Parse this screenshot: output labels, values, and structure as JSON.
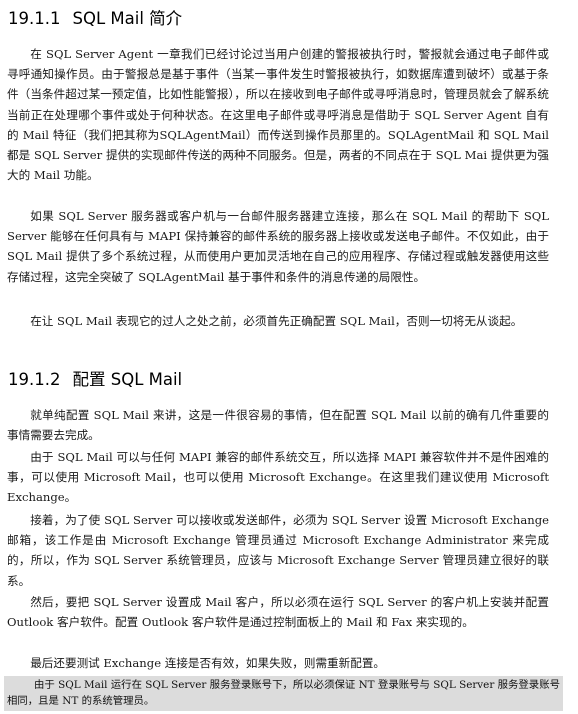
{
  "section1": {
    "number": "19.1.1",
    "title": "SQL Mail 简介",
    "paragraphs": [
      "在 SQL Server Agent 一章我们已经讨论过当用户创建的警报被执行时，警报就会通过电子邮件或寻呼通知操作员。由于警报总是基于事件（当某一事件发生时警报被执行，如数据库遭到破坏）或基于条件（当条件超过某一预定值，比如性能警报），所以在接收到电子邮件或寻呼消息时，管理员就会了解系统当前正在处理哪个事件或处于何种状态。在这里电子邮件或寻呼消息是借助于 SQL Server Agent 自有的 Mail 特征（我们把其称为SQLAgentMail）而传送到操作员那里的。SQLAgentMail 和 SQL Mail 都是 SQL Server 提供的实现邮件传送的两种不同服务。但是，两者的不同点在于 SQL Mai 提供更为强大的 Mail 功能。",
      "如果 SQL Server 服务器或客户机与一台邮件服务器建立连接，那么在 SQL Mail 的帮助下 SQL Server 能够在任何具有与 MAPI 保持兼容的邮件系统的服务器上接收或发送电子邮件。不仅如此，由于 SQL Mail 提供了多个系统过程，从而使用户更加灵活地在自己的应用程序、存储过程或触发器使用这些存储过程，这完全突破了 SQLAgentMail 基于事件和条件的消息传递的局限性。",
      "在让 SQL Mail 表现它的过人之处之前，必须首先正确配置 SQL Mail，否则一切将无从谈起。"
    ]
  },
  "section2": {
    "number": "19.1.2",
    "title": "配置 SQL Mail",
    "paragraphs": [
      "就单纯配置 SQL Mail 来讲，这是一件很容易的事情，但在配置 SQL Mail 以前的确有几件重要的事情需要去完成。",
      "由于 SQL Mail 可以与任何 MAPI 兼容的邮件系统交互，所以选择 MAPI 兼容软件并不是件困难的事，可以使用 Microsoft Mail，也可以使用 Microsoft Exchange。在这里我们建议使用 Microsoft Exchange。",
      "接着，为了使 SQL Server 可以接收或发送邮件，必须为 SQL Server 设置 Microsoft Exchange 邮箱，该工作是由 Microsoft Exchange 管理员通过 Microsoft Exchange Administrator 来完成的，所以，作为 SQL Server 系统管理员，应该与 Microsoft Exchange Server 管理员建立很好的联系。",
      "然后，要把 SQL Server 设置成 Mail 客户，所以必须在运行 SQL Server 的客户机上安装并配置 Outlook 客户软件。配置 Outlook 客户软件是通过控制面板上的 Mail 和 Fax 来实现的。",
      "最后还要测试 Exchange 连接是否有效，如果失败，则需重新配置。"
    ],
    "note": "由于 SQL Mail 运行在 SQL Server 服务登录账号下，所以必须保证 NT 登录账号与 SQL Server 服务登录账号相同，且是 NT 的系统管理员。"
  }
}
